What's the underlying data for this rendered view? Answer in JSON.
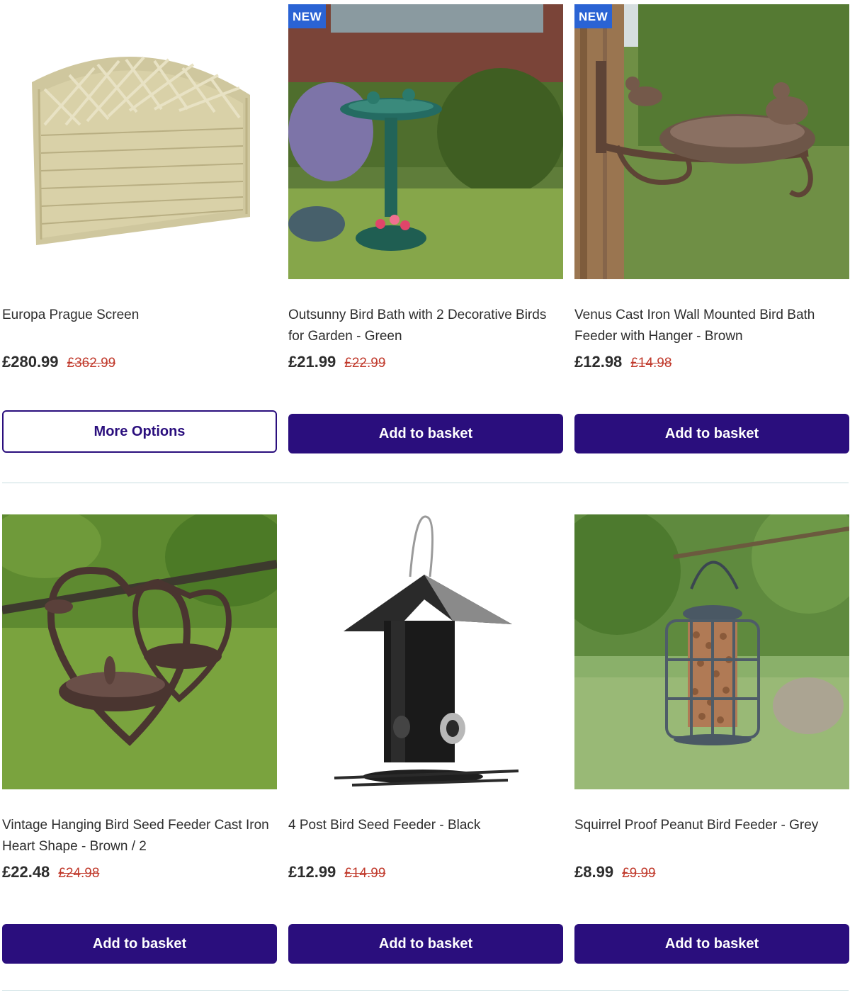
{
  "colors": {
    "button_primary": "#2a0e7d",
    "badge_new": "#2a63d4",
    "old_price": "#c0392b",
    "divider": "#c7dde0"
  },
  "products": [
    {
      "image_icon": "fence-panel-image",
      "badge": "",
      "title": "Europa Prague Screen",
      "price": "£280.99",
      "old_price": "£362.99",
      "button": "More Options"
    },
    {
      "image_icon": "bird-bath-image",
      "badge": "NEW",
      "title": "Outsunny Bird Bath with 2 Decorative Birds for Garden - Green",
      "price": "£21.99",
      "old_price": "£22.99",
      "button": "Add to basket"
    },
    {
      "image_icon": "wall-bird-bath-image",
      "badge": "NEW",
      "title": "Venus Cast Iron Wall Mounted Bird Bath Feeder with Hanger - Brown",
      "price": "£12.98",
      "old_price": "£14.98",
      "button": "Add to basket"
    },
    {
      "image_icon": "heart-feeder-image",
      "badge": "",
      "title": "Vintage Hanging Bird Seed Feeder Cast Iron Heart Shape - Brown / 2",
      "price": "£22.48",
      "old_price": "£24.98",
      "button": "Add to basket"
    },
    {
      "image_icon": "seed-feeder-image",
      "badge": "",
      "title": "4 Post Bird Seed Feeder - Black",
      "price": "£12.99",
      "old_price": "£14.99",
      "button": "Add to basket"
    },
    {
      "image_icon": "peanut-feeder-image",
      "badge": "",
      "title": "Squirrel Proof Peanut Bird Feeder - Grey",
      "price": "£8.99",
      "old_price": "£9.99",
      "button": "Add to basket"
    }
  ]
}
